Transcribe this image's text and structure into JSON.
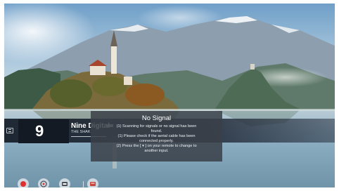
{
  "channel": {
    "number": "9",
    "name": "Nine Digital",
    "program": "THE SHAK"
  },
  "dialog": {
    "title": "No Signal",
    "lines": [
      "(1) Scanning for signals or no signal has been",
      "found.",
      "(1) Please check if the aerial cable has been",
      "connected properly.",
      "(2) Press the [ ▾ ] on your remote to change to",
      "another input."
    ]
  },
  "bottom_buttons": [
    {
      "icon": "record-icon",
      "color": "#e0302c"
    },
    {
      "icon": "timer-icon"
    },
    {
      "icon": "input-icon"
    },
    {
      "icon": "live-tv-icon"
    }
  ],
  "colors": {
    "banner": "#141a24",
    "dialog": "#3a4048",
    "record": "#e0302c",
    "sky": "#8fb6d6",
    "lake": "#7fa7bf"
  }
}
